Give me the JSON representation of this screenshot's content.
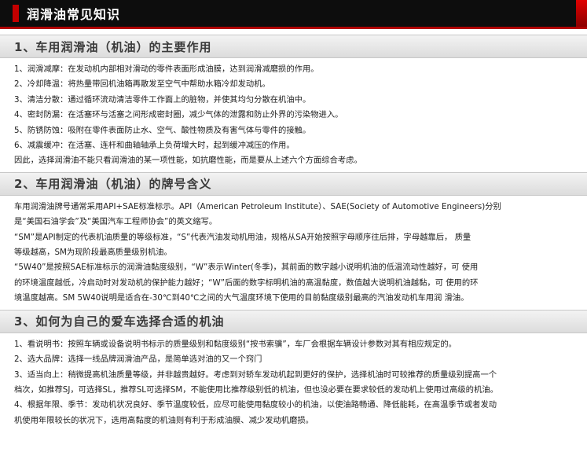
{
  "page_title": "润滑油常见知识",
  "sections": [
    {
      "heading": "1、车用润滑油（机油）的主要作用",
      "lines": [
        "1、润滑减摩：在发动机内部相对滑动的零件表面形成油膜，达到润滑减磨损的作用。",
        "2、冷却降温：将热量带回机油箱再散发至空气中帮助水箱冷却发动机。",
        "3、清洁分散：通过循环流动清洁零件工作面上的脏物，并使其均匀分散在机油中。",
        "4、密封防漏：在活塞环与活塞之间形成密封圈，减少气体的泄露和防止外界的污染物进入。",
        "5、防锈防蚀：吸附在零件表面防止水、空气、酸性物质及有害气体与零件的接触。",
        "6、减震缓冲：在活塞、连杆和曲轴轴承上负荷增大时，起到缓冲减压的作用。",
        "因此，选择润滑油不能只看润滑油的某一项性能，如抗磨性能，而是要从上述六个方面综合考虑。"
      ]
    },
    {
      "heading": "2、车用润滑油（机油）的牌号含义",
      "lines": [
        "车用润滑油牌号通常采用API+SAE标准标示。API（American Petroleum Institute）、SAE(Society of Automotive Engineers)分别",
        "是“美国石油学会”及“美国汽车工程师协会”的英文缩写。",
        "“SM”是API制定的代表机油质量的等级标准，“S”代表汽油发动机用油，规格从SA开始按照字母顺序往后排，字母越靠后， 质量",
        "等级越高，SM为现阶段最高质量级别机油。",
        "“5W40”是按照SAE标准标示的润滑油黏度级别，“W”表示Winter(冬季)，其前面的数字越小说明机油的低温流动性越好，可 使用",
        "的环境温度越低，冷启动时对发动机的保护能力越好；“W”后面的数字标明机油的高温黏度，数值越大说明机油越黏，可 使用的环",
        "境温度越高。SM 5W40说明是适合在-30℃到40℃之间的大气温度环境下使用的目前黏度级别最高的汽油发动机车用润 滑油。"
      ]
    },
    {
      "heading": "3、如何为自己的爱车选择合适的机油",
      "lines": [
        "1、看说明书：按照车辆或设备说明书标示的质量级别和黏度级别“按书索骥”，车厂会根据车辆设计参数对其有相应规定的。",
        "2、选大品牌：选择一线品牌润滑油产品，是简单选对油的又一个窍门",
        "3、适当向上：稍微提高机油质量等级，并非越贵越好。考虑到对轿车发动机起到更好的保护，选择机油时可较推荐的质量级别提高一个",
        "档次，如推荐SJ，可选择SL，推荐SL可选择SM，不能使用比推荐级别低的机油，但也没必要在要求较低的发动机上使用过高级的机油。",
        "4、根据年限、季节：发动机状况良好、季节温度较低，应尽可能使用黏度较小的机油，以使油路畅通、降低能耗，在高温季节或者发动",
        "机使用年限较长的状况下，选用高黏度的机油则有利于形成油膜、减少发动机磨损。"
      ]
    }
  ]
}
